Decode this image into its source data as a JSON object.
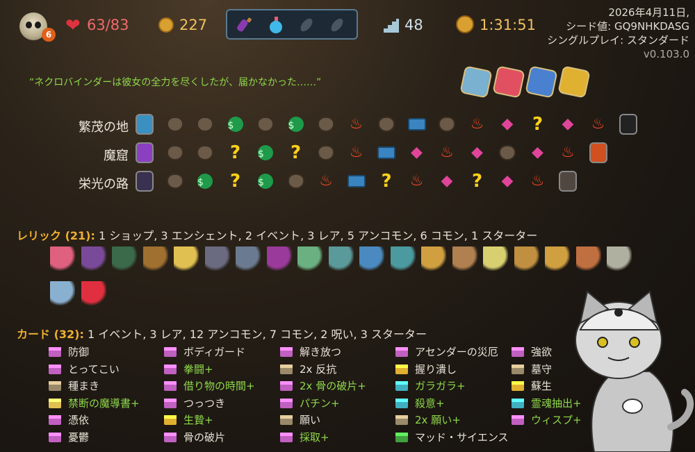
{
  "hud": {
    "ascension": "6",
    "hp": "63/83",
    "gold": "227",
    "floor": "48",
    "time": "1:31:51",
    "date": "2026年4月11日,",
    "seed": "シード値: GQ9NHKDASG",
    "mode": "シングルプレイ: スタンダード",
    "version": "v0.103.0",
    "potions": [
      "purple-potion-icon",
      "blue-flask-icon",
      "empty-potion-slot-icon",
      "empty-potion-slot-icon"
    ]
  },
  "quote": "“ネクロバインダーは彼女の全力を尽くしたが、届かなかった……”",
  "blessings": [
    "map-flag-icon",
    "heart-card-icon",
    "eye-card-icon",
    "gold-card-icon"
  ],
  "acts": [
    {
      "name": "繁茂の地",
      "nodes": [
        "boss-blue",
        "m",
        "m",
        "s",
        "m",
        "s",
        "m",
        "f",
        "m",
        "t",
        "m",
        "f",
        "e",
        "q",
        "e",
        "f",
        "boss-dark"
      ]
    },
    {
      "name": "魔窟",
      "nodes": [
        "boss-purple",
        "m",
        "m",
        "q",
        "s",
        "q",
        "m",
        "f",
        "t",
        "e",
        "f",
        "e",
        "m",
        "e",
        "f",
        "boss-red"
      ]
    },
    {
      "name": "栄光の路",
      "nodes": [
        "boss-demon",
        "m",
        "s",
        "q",
        "s",
        "m",
        "f",
        "t",
        "q",
        "f",
        "e",
        "q",
        "e",
        "f",
        "boss-gray"
      ]
    }
  ],
  "relics": {
    "label": "レリック (21):",
    "summary": "1 ショップ, 3 エンシェント, 2 イベント, 3 レア, 5 アンコモン, 6 コモン, 1 スターター",
    "colors": [
      "#e06080",
      "#7a4a9a",
      "#3a6a4a",
      "#a07030",
      "#e0c050",
      "#6a6a80",
      "#6a7a90",
      "#9a3a9a",
      "#6ab080",
      "#5a9a9a",
      "#4a8ac0",
      "#4a9aa0",
      "#d0a040",
      "#b08050",
      "#d8d070",
      "#c09040",
      "#d0a040",
      "#c07040",
      "#b0b0a0",
      "#8ab0d0",
      "#e03040"
    ]
  },
  "cards": {
    "label": "カード (32):",
    "summary": "1 イベント, 3 レア, 12 アンコモン, 7 コモン, 2 呪い, 3 スターター",
    "columns": [
      [
        {
          "name": "防御",
          "up": false,
          "color": "#c060c0"
        },
        {
          "name": "とってこい",
          "up": false,
          "color": "#c060c0"
        },
        {
          "name": "種まき",
          "up": false,
          "color": "#9a8a6a"
        },
        {
          "name": "禁断の魔導書+",
          "up": true,
          "color": "#e0c050"
        },
        {
          "name": "憑依",
          "up": false,
          "color": "#c060c0"
        },
        {
          "name": "憂鬱",
          "up": false,
          "color": "#c060c0"
        }
      ],
      [
        {
          "name": "ボディガード",
          "up": false,
          "color": "#c060c0"
        },
        {
          "name": "拳闘+",
          "up": true,
          "color": "#c060c0"
        },
        {
          "name": "借り物の時間+",
          "up": true,
          "color": "#c060c0"
        },
        {
          "name": "つっつき",
          "up": false,
          "color": "#c060c0"
        },
        {
          "name": "生贄+",
          "up": true,
          "color": "#e0b030"
        },
        {
          "name": "骨の破片",
          "up": false,
          "color": "#c060c0"
        }
      ],
      [
        {
          "name": "解き放つ",
          "up": false,
          "color": "#c060c0"
        },
        {
          "name": "2x 反抗",
          "up": false,
          "color": "#9a8a6a"
        },
        {
          "name": "2x 骨の破片+",
          "up": true,
          "color": "#c060c0"
        },
        {
          "name": "パチン+",
          "up": true,
          "color": "#c060c0"
        },
        {
          "name": "願い",
          "up": false,
          "color": "#9a8a6a"
        },
        {
          "name": "採取+",
          "up": true,
          "color": "#c060c0"
        }
      ],
      [
        {
          "name": "アセンダーの災厄",
          "up": false,
          "color": "#c060c0"
        },
        {
          "name": "握り潰し",
          "up": false,
          "color": "#e0b030"
        },
        {
          "name": "ガラガラ+",
          "up": true,
          "color": "#40b0c0"
        },
        {
          "name": "殺意+",
          "up": true,
          "color": "#40b0c0"
        },
        {
          "name": "2x 願い+",
          "up": true,
          "color": "#9a8a6a"
        },
        {
          "name": "マッド・サイエンス",
          "up": false,
          "color": "#40a040"
        }
      ],
      [
        {
          "name": "強欲",
          "up": false,
          "color": "#c060c0"
        },
        {
          "name": "墓守",
          "up": false,
          "color": "#9a8a6a"
        },
        {
          "name": "蘇生",
          "up": false,
          "color": "#e0b030"
        },
        {
          "name": "霊魂抽出+",
          "up": true,
          "color": "#40b0c0"
        },
        {
          "name": "ウィスプ+",
          "up": true,
          "color": "#c060c0"
        }
      ]
    ]
  }
}
